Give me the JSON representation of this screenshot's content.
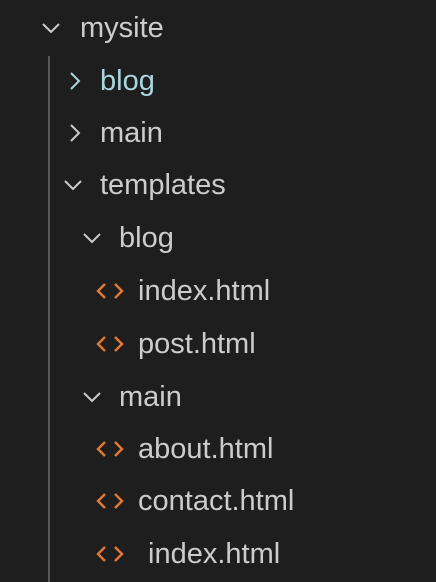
{
  "tree": {
    "root": {
      "label": "mysite",
      "expanded": true
    },
    "items": [
      {
        "label": "blog",
        "type": "folder",
        "expanded": false,
        "highlight": true
      },
      {
        "label": "main",
        "type": "folder",
        "expanded": false
      },
      {
        "label": "templates",
        "type": "folder",
        "expanded": true
      },
      {
        "label": "blog",
        "type": "folder",
        "expanded": true
      },
      {
        "label": "index.html",
        "type": "file",
        "icon": "html-file-icon"
      },
      {
        "label": "post.html",
        "type": "file",
        "icon": "html-file-icon"
      },
      {
        "label": "main",
        "type": "folder",
        "expanded": true
      },
      {
        "label": "about.html",
        "type": "file",
        "icon": "html-file-icon"
      },
      {
        "label": "contact.html",
        "type": "file",
        "icon": "html-file-icon"
      },
      {
        "label": "index.html",
        "type": "file",
        "icon": "html-file-icon"
      }
    ]
  },
  "colors": {
    "background": "#1e1e1e",
    "text": "#cccccc",
    "highlight_text": "#a8d6dd",
    "html_icon": "#e37933",
    "indent_guide": "#585858"
  }
}
